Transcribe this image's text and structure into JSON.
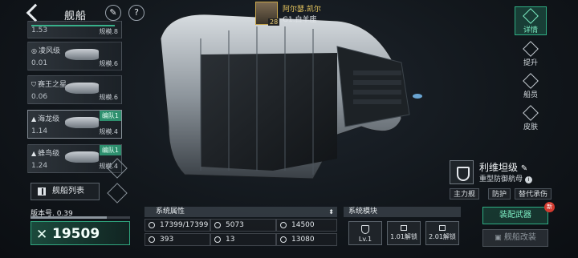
{
  "header": {
    "title": "舰船"
  },
  "captain": {
    "name": "阿尔瑟.凯尔",
    "constellation": "G1.白羊座",
    "level": "28"
  },
  "ship_list": [
    {
      "number": "1.53",
      "scale": "规模.8",
      "name": ""
    },
    {
      "number": "0.01",
      "scale": "规模.6",
      "name": "凌风级"
    },
    {
      "number": "0.06",
      "scale": "规模.6",
      "name": "赛王之星"
    },
    {
      "number": "1.14",
      "scale": "规模.4",
      "name": "海龙级",
      "fleet": "编队1"
    },
    {
      "number": "1.24",
      "scale": "规模.4",
      "name": "蜂鸟级",
      "fleet": "编队1"
    }
  ],
  "fleet_list_label": "舰船列表",
  "nav": [
    {
      "label": "详情"
    },
    {
      "label": "提升"
    },
    {
      "label": "船员"
    },
    {
      "label": "皮肤"
    }
  ],
  "ship_info": {
    "class_name": "利维坦级",
    "type": "重型防御航母",
    "tags": [
      "主力舰",
      "防护",
      "替代承伤"
    ]
  },
  "version": {
    "label": "版本号. 0.39",
    "progress": 0.77
  },
  "power": "19509",
  "attributes": {
    "title": "系统属性",
    "items": [
      {
        "value": "17399/17399",
        "icon": "hull-icon"
      },
      {
        "value": "5073",
        "icon": "armor-icon"
      },
      {
        "value": "14500",
        "icon": "shield-stat-icon"
      },
      {
        "value": "393",
        "icon": "speed-icon"
      },
      {
        "value": "13",
        "icon": "crew-icon"
      },
      {
        "value": "13080",
        "icon": "firepower-icon"
      }
    ]
  },
  "modules": {
    "title": "系统模块",
    "slots": [
      {
        "label": "Lv.1"
      },
      {
        "label": "1.01解锁"
      },
      {
        "label": "2.01解锁"
      }
    ]
  },
  "buttons": {
    "equip": "装配武器",
    "equip_badge": "新",
    "refit": "舰船改装"
  },
  "colors": {
    "accent": "#2fae84",
    "accent_text": "#7ff0c6",
    "badge": "#d33a2f"
  }
}
